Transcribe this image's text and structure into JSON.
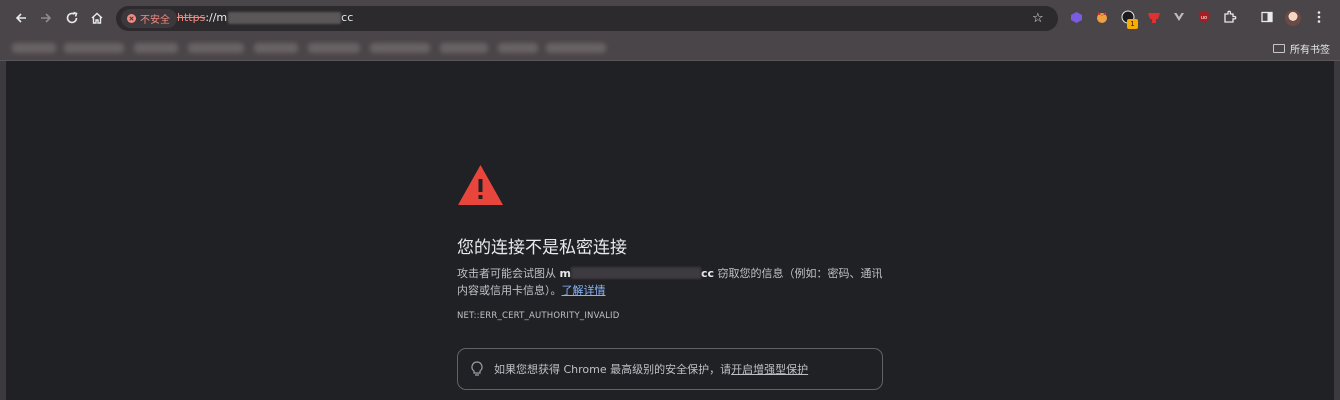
{
  "toolbar": {
    "back_icon": "arrow-left-icon",
    "forward_icon": "arrow-right-icon",
    "reload_icon": "reload-icon",
    "home_icon": "home-icon",
    "security_label": "不安全",
    "url_scheme": "https",
    "url_prefix": "://m",
    "url_suffix": "cc",
    "bookmark_star_icon": "star-icon",
    "extension_badge": "1",
    "extensions_icon": "puzzle-icon",
    "side_panel_icon": "side-panel-icon",
    "menu_icon": "kebab-menu-icon"
  },
  "bookmarks_bar": {
    "all_bookmarks_label": "所有书签"
  },
  "interstitial": {
    "title": "您的连接不是私密连接",
    "desc_prefix": "攻击者可能会试图从 ",
    "host_start": "m",
    "host_end": "cc",
    "desc_suffix": " 窃取您的信息（例如：密码、通讯内容或信用卡信息）。",
    "learn_more": "了解详情",
    "error_code": "NET::ERR_CERT_AUTHORITY_INVALID",
    "promo_text": "如果您想获得 Chrome 最高级别的安全保护，请",
    "promo_link": "开启增强型保护"
  },
  "colors": {
    "background": "#202124",
    "warning_red": "#e8453c",
    "link_blue": "#8ab4f8",
    "insecure_red": "#f28b82"
  }
}
